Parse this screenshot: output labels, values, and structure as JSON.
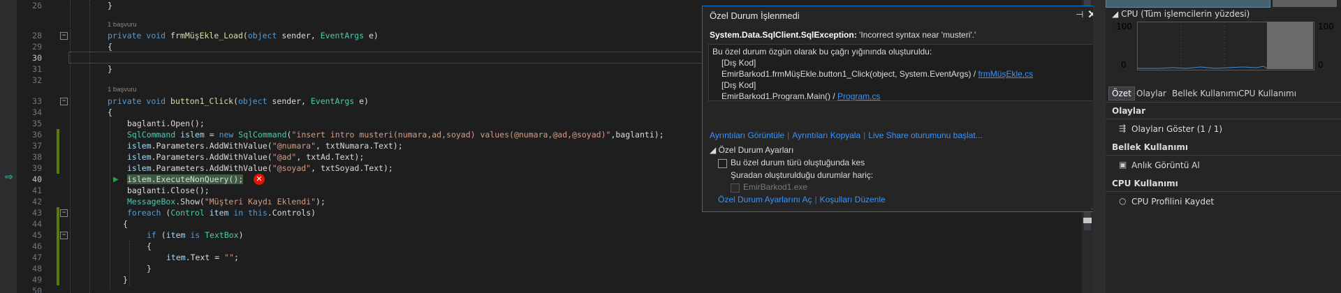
{
  "editor": {
    "line_numbers": [
      "26",
      "28",
      "29",
      "30",
      "31",
      "32",
      "33",
      "34",
      "35",
      "36",
      "37",
      "38",
      "39",
      "40",
      "41",
      "42",
      "43",
      "44",
      "45",
      "46",
      "47",
      "48",
      "49",
      "50"
    ],
    "ref_count_1": "1 başvuru",
    "ref_count_2": "1 başvuru",
    "lines": {
      "l26": "}",
      "l28_kw1": "private",
      "l28_kw2": "void",
      "l28_fn": "frmMüşEkle_Load",
      "l28_p1": "(",
      "l28_kw3": "object",
      "l28_p2": " sender, ",
      "l28_ty": "EventArgs",
      "l28_p3": " e)",
      "l29": "{",
      "l31": "}",
      "l33_kw1": "private",
      "l33_kw2": "void",
      "l33_fn": "button1_Click",
      "l33_p1": "(",
      "l33_kw3": "object",
      "l33_p2": " sender, ",
      "l33_ty": "EventArgs",
      "l33_p3": " e)",
      "l34": "{",
      "l35": "baglanti.Open();",
      "l36_ty1": "SqlCommand",
      "l36_vr": " islem",
      "l36_p1": " = ",
      "l36_kw": "new",
      "l36_ty2": " SqlCommand",
      "l36_p2": "(",
      "l36_st": "\"insert intro musteri(numara,ad,soyad) values(@numara,@ad,@soyad)\"",
      "l36_p3": ",baglanti);",
      "l37_vr": "islem",
      "l37_p1": ".Parameters.AddWithValue(",
      "l37_st": "\"@numara\"",
      "l37_p2": ", txtNumara.Text);",
      "l38_vr": "islem",
      "l38_p1": ".Parameters.AddWithValue(",
      "l38_st": "\"@ad\"",
      "l38_p2": ", txtAd.Text);",
      "l39_vr": "islem",
      "l39_p1": ".Parameters.AddWithValue(",
      "l39_st": "\"@soyad\"",
      "l39_p2": ", txtSoyad.Text);",
      "l40_hl": "islem.ExecuteNonQuery();",
      "l41": "baglanti.Close();",
      "l42_ty": "MessageBox",
      "l42_p1": ".Show(",
      "l42_st": "\"Müşteri Kaydı Eklendi\"",
      "l42_p2": ");",
      "l43_kw1": "foreach",
      "l43_p1": " (",
      "l43_ty": "Control",
      "l43_vr": " item",
      "l43_kw2": " in",
      "l43_kw3": " this",
      "l43_p2": ".Controls)",
      "l44": "{",
      "l45_kw1": "if",
      "l45_p1": " (",
      "l45_vr": "item",
      "l45_kw2": " is",
      "l45_ty": " TextBox",
      "l45_p2": ")",
      "l46": "{",
      "l47_vr": "item",
      "l47_p1": ".Text = ",
      "l47_st": "\"\"",
      "l47_p2": ";",
      "l48": "}",
      "l49": "}"
    }
  },
  "exception": {
    "title": "Özel Durum İşlenmedi",
    "exception_type": "System.Data.SqlClient.SqlException:",
    "exception_message": " 'Incorrect syntax near 'musteri'.'",
    "stack_intro": "Bu özel durum özgün olarak bu çağrı yığınında oluşturuldu:",
    "stack": {
      "s1": "[Dış Kod]",
      "s2_text": "EmirBarkod1.frmMüşEkle.button1_Click(object, System.EventArgs) / ",
      "s2_link": "frmMüşEkle.cs",
      "s3": "[Dış Kod]",
      "s4_text": "EmirBarkod1.Program.Main() / ",
      "s4_link": "Program.cs"
    },
    "links": {
      "view_details": "Ayrıntıları Görüntüle",
      "copy_details": "Ayrıntıları Kopyala",
      "live_share": "Live Share oturumunu başlat..."
    },
    "settings": {
      "header": "Özel Durum Ayarları",
      "break_when": "Bu özel durum türü oluştuğunda kes",
      "except_from": "Şuradan oluşturulduğu durumlar hariç:",
      "module": "EmirBarkod1.exe",
      "open_settings": "Özel Durum Ayarlarını Aç",
      "edit_conditions": "Koşulları Düzenle"
    }
  },
  "diagnostics": {
    "cpu_header": "CPU (Tüm işlemcilerin yüzdesi)",
    "y_top_left": "100",
    "y_top_right": "100",
    "y_bottom_left": "0",
    "y_bottom_right": "0",
    "tabs": [
      "Özet",
      "Olaylar",
      "Bellek Kullanımı",
      "CPU Kullanımı"
    ],
    "events_header": "Olaylar",
    "show_events": "Olayları Göster (1 / 1)",
    "memory_header": "Bellek Kullanımı",
    "take_snapshot": "Anlık Görüntü Al",
    "cpu_usage_header": "CPU Kullanımı",
    "record_cpu_profile": "CPU Profilini Kaydet"
  },
  "colors": {
    "accent": "#007acc",
    "error": "#e51400",
    "link": "#3794ff"
  }
}
